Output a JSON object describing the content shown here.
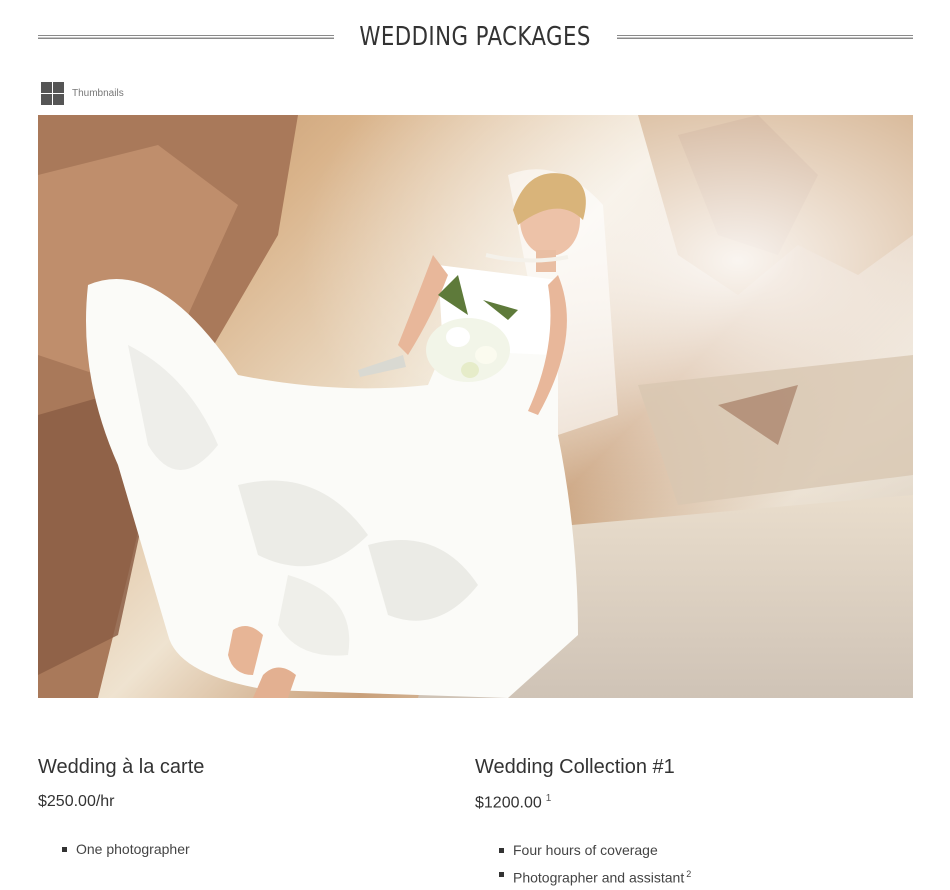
{
  "page": {
    "title": "WEDDING PACKAGES"
  },
  "gallery": {
    "thumbnails_label": "Thumbnails",
    "icon": "grid-icon"
  },
  "packages": [
    {
      "name": "Wedding à la carte",
      "price": "$250.00/hr",
      "footnote": "",
      "items": [
        {
          "text": "One photographer",
          "note": ""
        }
      ]
    },
    {
      "name": "Wedding Collection #1",
      "price": "$1200.00",
      "footnote": "1",
      "items": [
        {
          "text": "Four hours of coverage",
          "note": ""
        },
        {
          "text": "Photographer and assistant",
          "note": "2"
        }
      ]
    }
  ],
  "colors": {
    "text": "#333333",
    "rule": "#8a8a8a",
    "icon": "#555555"
  }
}
